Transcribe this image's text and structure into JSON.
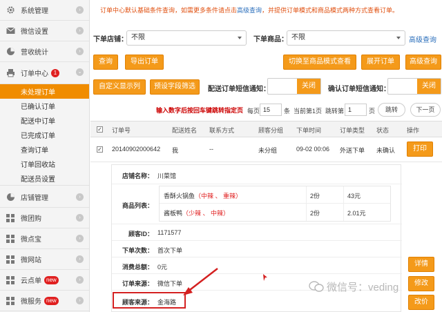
{
  "sidebar": {
    "groups": [
      {
        "label": "系统管理",
        "icon": "gear-icon"
      },
      {
        "label": "微信设置",
        "icon": "mail-icon"
      },
      {
        "label": "营收统计",
        "icon": "pie-chart-icon"
      }
    ],
    "order_center": {
      "label": "订单中心",
      "badge": "1",
      "icon": "printer-icon"
    },
    "order_sub_items": [
      "未处理订单",
      "已确认订单",
      "配送中订单",
      "已完成订单",
      "查询订单",
      "订单回收站",
      "配送员设置"
    ],
    "bottom_groups": [
      {
        "label": "店铺管理",
        "icon": "pie-chart-icon"
      },
      {
        "label": "微团购",
        "icon": "grid-icon"
      },
      {
        "label": "微点宝",
        "icon": "grid-icon"
      },
      {
        "label": "微网站",
        "icon": "grid-icon"
      },
      {
        "label": "云点单",
        "icon": "grid-icon",
        "badge": "new"
      },
      {
        "label": "微服务",
        "icon": "grid-icon",
        "badge": "new"
      }
    ]
  },
  "notice": {
    "prefix": "订单中心默认基础条件查询，如需更多条件请点击",
    "link": "高级查询",
    "suffix": "，并提供订单模式和商品模式两种方式查看订单。"
  },
  "filters": {
    "shop_label": "下单店铺：",
    "shop_value": "不限",
    "product_label": "下单商品：",
    "product_value": "不限",
    "advanced_link": "高级查询"
  },
  "buttons": {
    "query": "查询",
    "export": "导出订单",
    "switch_mode": "切换至商品模式查看",
    "expand": "展开订单",
    "advanced": "高级查询",
    "custom_cols": "自定义显示列",
    "preset_filter": "预设字段筛选"
  },
  "notify": {
    "delivery_label": "配送订单短信通知：",
    "delivery_state": "关闭",
    "confirm_label": "确认订单短信通知：",
    "confirm_state": "关闭"
  },
  "pager": {
    "hint": "输入数字后按回车键跳转指定页",
    "per_page_label": "每页",
    "per_page_value": "15",
    "per_page_unit": "条",
    "current": "当前第1页",
    "jump_label": "跳转第",
    "jump_value": "1",
    "jump_unit": "页",
    "jump_button": "跳转",
    "next_button": "下一页"
  },
  "table": {
    "headers": [
      "订单号",
      "配送姓名",
      "联系方式",
      "顾客分组",
      "下单时间",
      "订单类型",
      "状态",
      "操作"
    ],
    "row": {
      "order_no": "20140902000642",
      "name": "我",
      "contact": "--",
      "group": "未分组",
      "time": "09-02 00:06",
      "type": "外送下单",
      "status": "未确认",
      "action": "打印"
    }
  },
  "detail": {
    "shop_key": "店铺名称：",
    "shop_val": "川菜馆",
    "items_key": "商品列表：",
    "items": [
      {
        "name": "香酥火锅鱼",
        "spice": "（中辣 、 重辣）",
        "qty": "2份",
        "price": "43元"
      },
      {
        "name": "酱板鸭",
        "spice": "（少辣 、 中辣）",
        "qty": "2份",
        "price": "2.01元"
      }
    ],
    "customer_id_key": "顾客ID：",
    "customer_id_val": "1171577",
    "order_count_key": "下单次数：",
    "order_count_val": "首次下单",
    "total_key": "消费总额：",
    "total_val": "0元",
    "source_key": "订单来源：",
    "source_val": "微信下单",
    "customer_source_key": "顾客来源：",
    "customer_source_val": "金海路"
  },
  "side_actions": [
    "详情",
    "修改",
    "改价"
  ],
  "watermark": "微信号：veding"
}
